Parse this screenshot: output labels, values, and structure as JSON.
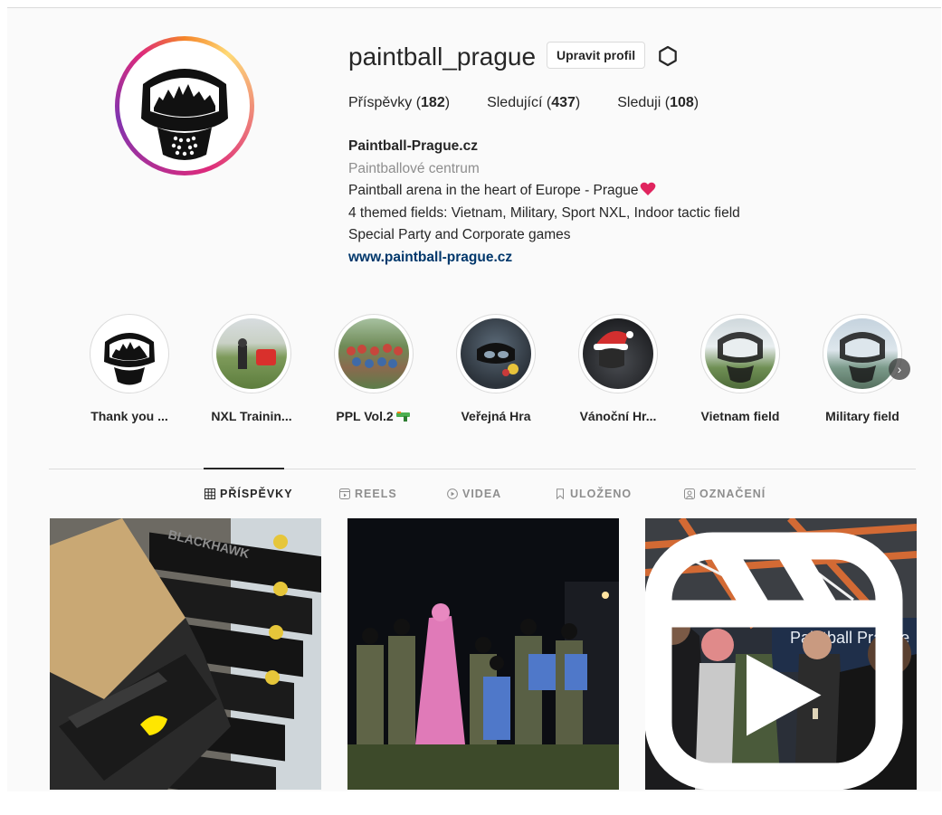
{
  "profile": {
    "username": "paintball_prague",
    "edit_button": "Upravit profil",
    "stats": [
      {
        "label": "Příspěvky",
        "value": "182"
      },
      {
        "label": "Sledující",
        "value": "437"
      },
      {
        "label": "Sleduji",
        "value": "108"
      }
    ],
    "bio": {
      "name": "Paintball-Prague.cz",
      "category": "Paintballové centrum",
      "line1": "Paintball arena in the heart of Europe - Prague",
      "line1_emoji": "heart",
      "line2": "4 themed fields: Vietnam, Military, Sport NXL, Indoor tactic field",
      "line3": "Special Party and Corporate games",
      "website": "www.paintball-prague.cz"
    }
  },
  "highlights": [
    {
      "label": "Thank you ..."
    },
    {
      "label": "NXL Trainin..."
    },
    {
      "label": "PPL Vol.2"
    },
    {
      "label": "Veřejná Hra"
    },
    {
      "label": "Vánoční Hr..."
    },
    {
      "label": "Vietnam field"
    },
    {
      "label": "Military field"
    }
  ],
  "tabs": [
    {
      "label": "PŘÍSPĚVKY",
      "icon": "grid-icon",
      "active": true
    },
    {
      "label": "REELS",
      "icon": "reels-icon",
      "active": false
    },
    {
      "label": "VIDEA",
      "icon": "play-icon",
      "active": false
    },
    {
      "label": "ULOŽENO",
      "icon": "bookmark-icon",
      "active": false
    },
    {
      "label": "OZNAČENÍ",
      "icon": "tag-icon",
      "active": false
    }
  ],
  "posts": [
    {
      "description": "box",
      "sign": "BLACKHAWK"
    },
    {
      "description": "team-photo-night"
    },
    {
      "description": "indoor-toast",
      "sign": "Paintball Prague",
      "badge": "reel-icon"
    }
  ],
  "colors": {
    "link": "#00376b",
    "muted": "#8e8e8e",
    "border": "#dbdbdb",
    "text": "#262626"
  }
}
